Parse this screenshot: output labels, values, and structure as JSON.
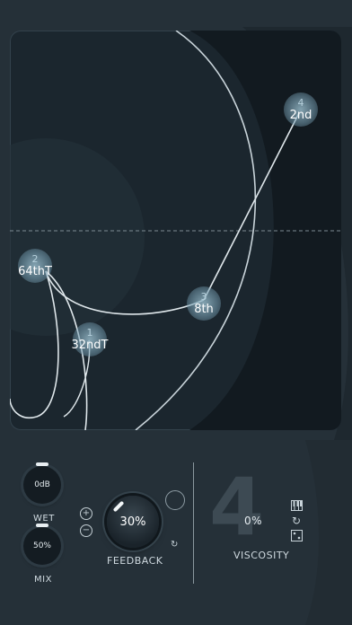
{
  "pad": {
    "nodes": [
      {
        "number": "4",
        "value": "2nd"
      },
      {
        "number": "2",
        "value": "64thT"
      },
      {
        "number": "3",
        "value": "8th"
      },
      {
        "number": "1",
        "value": "32ndT"
      }
    ]
  },
  "controls": {
    "gain_value": "0dB",
    "wet_label": "WET",
    "mix_value": "50%",
    "mix_label": "MIX",
    "plus_symbol": "+",
    "minus_symbol": "−",
    "feedback_value": "30%",
    "feedback_label": "FEEDBACK",
    "reset_symbol": "↻",
    "viscosity_big_number": "4",
    "viscosity_value": "0%",
    "viscosity_label": "VISCOSITY"
  },
  "icons": {
    "piano": "piano-icon",
    "cycle": "cycle-icon",
    "dice": "dice-icon"
  },
  "colors": {
    "background": "#253038",
    "pad": "#1b262e",
    "node": "#8fb4c4",
    "line": "#d9e2e7"
  }
}
